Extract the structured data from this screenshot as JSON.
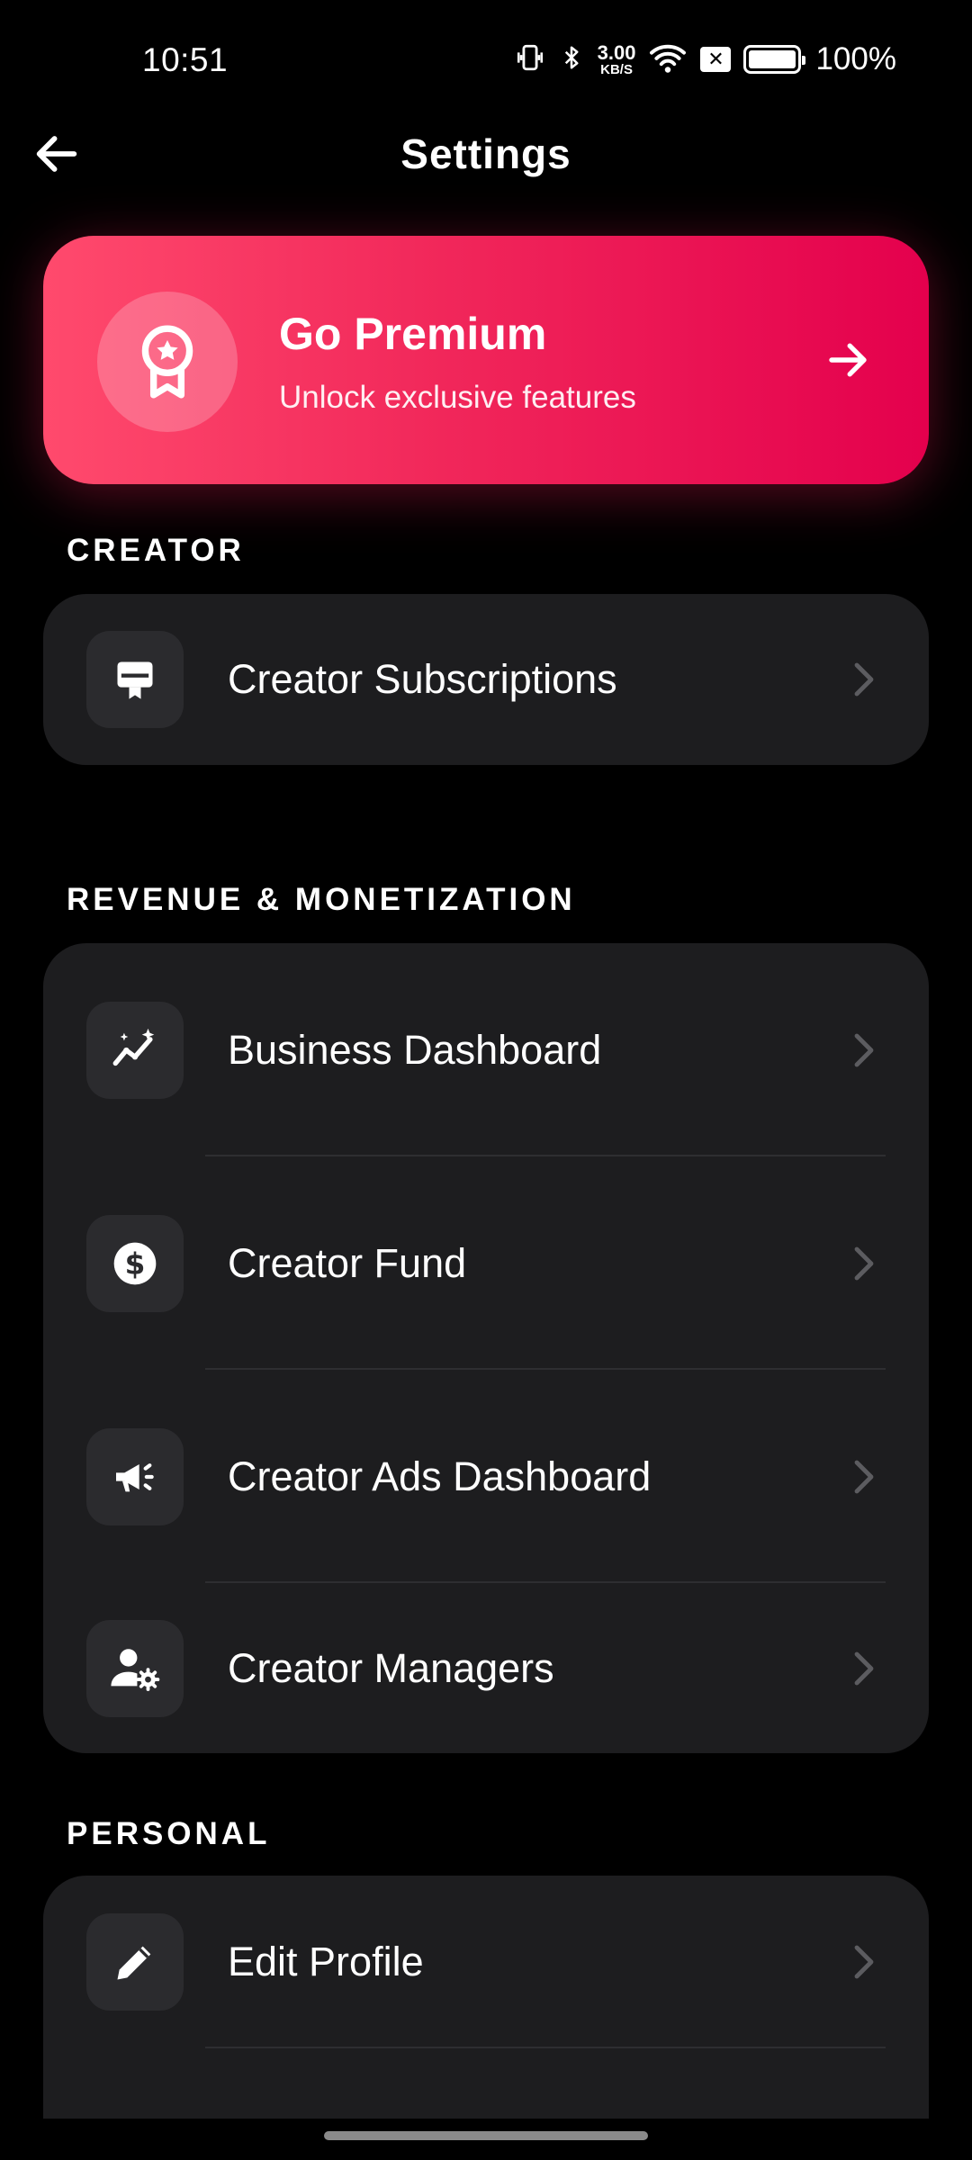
{
  "status_bar": {
    "time": "10:51",
    "net_speed_value": "3.00",
    "net_speed_unit": "KB/S",
    "battery_percent": "100%",
    "battery_level": 1.0
  },
  "header": {
    "title": "Settings"
  },
  "premium": {
    "title": "Go Premium",
    "subtitle": "Unlock exclusive features",
    "colors": {
      "start": "#ff4a6d",
      "end": "#e4004d"
    }
  },
  "sections": {
    "creator": {
      "label": "CREATOR",
      "items": [
        {
          "label": "Creator Subscriptions",
          "icon": "subscription-card-icon"
        }
      ]
    },
    "revenue": {
      "label": "REVENUE & MONETIZATION",
      "items": [
        {
          "label": "Business Dashboard",
          "icon": "sparkle-chart-icon"
        },
        {
          "label": "Creator Fund",
          "icon": "dollar-coin-icon"
        },
        {
          "label": "Creator Ads Dashboard",
          "icon": "megaphone-icon"
        },
        {
          "label": "Creator Managers",
          "icon": "user-gear-icon"
        }
      ]
    },
    "personal": {
      "label": "PERSONAL",
      "items": [
        {
          "label": "Edit Profile",
          "icon": "pencil-icon"
        }
      ]
    }
  }
}
